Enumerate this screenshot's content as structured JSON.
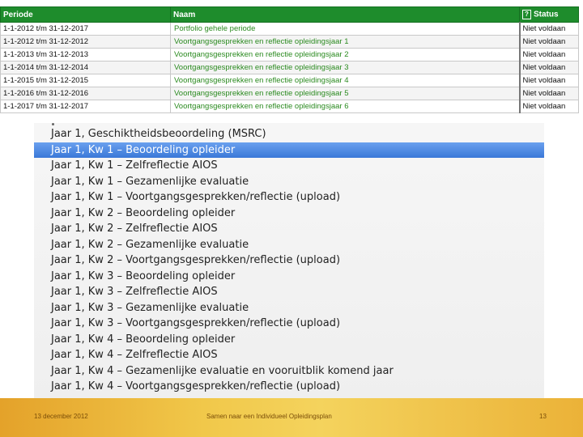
{
  "table": {
    "headers": {
      "periode": "Periode",
      "naam": "Naam",
      "status": "Status",
      "status_icon": "?"
    },
    "rows": [
      {
        "periode": "1-1-2012 t/m 31-12-2017",
        "naam": "Portfolio gehele periode",
        "status": "Niet voldaan"
      },
      {
        "periode": "1-1-2012 t/m 31-12-2012",
        "naam": "Voortgangsgesprekken en reflectie opleidingsjaar 1",
        "status": "Niet voldaan"
      },
      {
        "periode": "1-1-2013 t/m 31-12-2013",
        "naam": "Voortgangsgesprekken en reflectie opleidingsjaar 2",
        "status": "Niet voldaan"
      },
      {
        "periode": "1-1-2014 t/m 31-12-2014",
        "naam": "Voortgangsgesprekken en reflectie opleidingsjaar 3",
        "status": "Niet voldaan"
      },
      {
        "periode": "1-1-2015 t/m 31-12-2015",
        "naam": "Voortgangsgesprekken en reflectie opleidingsjaar 4",
        "status": "Niet voldaan"
      },
      {
        "periode": "1-1-2016 t/m 31-12-2016",
        "naam": "Voortgangsgesprekken en reflectie opleidingsjaar 5",
        "status": "Niet voldaan"
      },
      {
        "periode": "1-1-2017 t/m 31-12-2017",
        "naam": "Voortgangsgesprekken en reflectie opleidingsjaar 6",
        "status": "Niet voldaan"
      }
    ]
  },
  "list": {
    "items": [
      "Jaar 1, Geschiktheidsbeoordeling (MSRC)",
      "Jaar 1, Kw 1 – Beoordeling opleider",
      "Jaar 1, Kw 1 – Zelfreflectie AIOS",
      "Jaar 1, Kw 1 – Gezamenlijke evaluatie",
      "Jaar 1, Kw 1 – Voortgangsgesprekken/reflectie (upload)",
      "Jaar 1, Kw 2 – Beoordeling opleider",
      "Jaar 1, Kw 2 – Zelfreflectie AIOS",
      "Jaar 1, Kw 2 – Gezamenlijke evaluatie",
      "Jaar 1, Kw 2 – Voortgangsgesprekken/reflectie (upload)",
      "Jaar 1, Kw 3 – Beoordeling opleider",
      "Jaar 1, Kw 3 – Zelfreflectie AIOS",
      "Jaar 1, Kw 3 – Gezamenlijke evaluatie",
      "Jaar 1, Kw 3 – Voortgangsgesprekken/reflectie (upload)",
      "Jaar 1, Kw 4 – Beoordeling opleider",
      "Jaar 1, Kw 4 – Zelfreflectie AIOS",
      "Jaar 1, Kw 4 – Gezamenlijke evaluatie en vooruitblik komend jaar",
      "Jaar 1, Kw 4 – Voortgangsgesprekken/reflectie (upload)"
    ],
    "selected_index": 1
  },
  "footer": {
    "date": "13 december 2012",
    "title": "Samen naar een Individueel Opleidingsplan",
    "page": "13"
  },
  "colors": {
    "header_green": "#1e8c2c",
    "name_green": "#2a8a1f",
    "selection_blue": "#3a78d8",
    "footer_gold": "#f1c84a"
  }
}
